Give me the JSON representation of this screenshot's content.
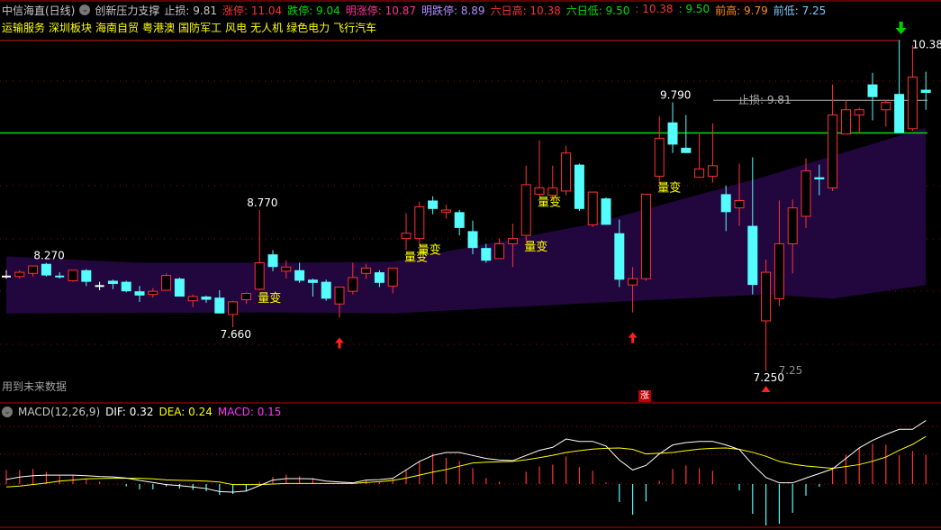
{
  "header": {
    "title": "中信海直(日线)",
    "indicator_name": "创新压力支撑",
    "items": [
      {
        "label": "止损:",
        "value": "9.81",
        "color": "#c8c8c8"
      },
      {
        "label": "涨停:",
        "value": "11.04",
        "color": "#ff3232"
      },
      {
        "label": "跌停:",
        "value": "9.04",
        "color": "#00e000"
      },
      {
        "label": "明涨停:",
        "value": "10.87",
        "color": "#ff3399"
      },
      {
        "label": "明跌停:",
        "value": "8.89",
        "color": "#b48cff"
      },
      {
        "label": "六日高:",
        "value": "10.38",
        "color": "#ff3232"
      },
      {
        "label": "六日低:",
        "value": "9.50",
        "color": "#00e000"
      },
      {
        "label": ":",
        "value": "10.38",
        "color": "#ff3232"
      },
      {
        "label": ":",
        "value": "9.50",
        "color": "#00e000"
      },
      {
        "label": "前高:",
        "value": "9.79",
        "color": "#ff8c1a"
      },
      {
        "label": "前低:",
        "value": "7.25",
        "color": "#80c8ff"
      }
    ]
  },
  "sectors": [
    "运输服务",
    "深圳板块",
    "海南自贸",
    "粤港澳",
    "国防军工",
    "风电",
    "无人机",
    "绿色电力",
    "飞行汽车"
  ],
  "future_data_note": "用到未来数据",
  "zhang_badge": "涨",
  "macd_header": {
    "name": "MACD(12,26,9)",
    "dif": "DIF: 0.32",
    "dea": "DEA: 0.24",
    "macd": "MACD: 0.15"
  },
  "colors": {
    "up": "#ff3232",
    "down": "#54fcfc",
    "band": "#22063e",
    "dif": "#ffffff",
    "dea": "#ffff00",
    "resistance": "#00e000",
    "label": "#ffff00"
  },
  "chart_data": {
    "type": "candlestick",
    "title": "中信海直(日线)",
    "ylim": [
      7.2,
      10.4
    ],
    "candles": [
      [
        8.14,
        8.2,
        8.12,
        8.14
      ],
      [
        8.14,
        8.2,
        8.12,
        8.18
      ],
      [
        8.17,
        8.24,
        8.14,
        8.24
      ],
      [
        8.26,
        8.27,
        8.14,
        8.15
      ],
      [
        8.14,
        8.18,
        8.12,
        8.13
      ],
      [
        8.1,
        8.2,
        8.09,
        8.2
      ],
      [
        8.2,
        8.21,
        8.05,
        8.09
      ],
      [
        8.05,
        8.09,
        8.01,
        8.05
      ],
      [
        8.1,
        8.11,
        8.02,
        8.07
      ],
      [
        8.09,
        8.1,
        7.99,
        8.0
      ],
      [
        8.0,
        8.05,
        7.9,
        7.96
      ],
      [
        7.97,
        8.03,
        7.94,
        8.0
      ],
      [
        8.01,
        8.17,
        8.01,
        8.15
      ],
      [
        8.12,
        8.13,
        7.95,
        7.95
      ],
      [
        7.91,
        7.97,
        7.85,
        7.95
      ],
      [
        7.95,
        7.96,
        7.89,
        7.92
      ],
      [
        7.94,
        8.01,
        7.79,
        7.79
      ],
      [
        7.78,
        7.91,
        7.66,
        7.9
      ],
      [
        7.92,
        7.99,
        7.88,
        7.98
      ],
      [
        8.02,
        8.77,
        8.01,
        8.27
      ],
      [
        8.35,
        8.39,
        8.19,
        8.23
      ],
      [
        8.19,
        8.29,
        8.12,
        8.23
      ],
      [
        8.2,
        8.27,
        8.08,
        8.1
      ],
      [
        8.11,
        8.12,
        7.95,
        8.08
      ],
      [
        8.09,
        8.11,
        7.91,
        7.93
      ],
      [
        7.88,
        8.04,
        7.75,
        8.04
      ],
      [
        8.0,
        8.27,
        7.97,
        8.13
      ],
      [
        8.17,
        8.26,
        8.12,
        8.22
      ],
      [
        8.18,
        8.2,
        8.04,
        8.08
      ],
      [
        8.05,
        8.22,
        7.98,
        8.22
      ],
      [
        8.5,
        8.74,
        8.39,
        8.55
      ],
      [
        8.5,
        8.85,
        8.43,
        8.8
      ],
      [
        8.86,
        8.9,
        8.73,
        8.78
      ],
      [
        8.75,
        8.82,
        8.69,
        8.77
      ],
      [
        8.75,
        8.77,
        8.53,
        8.6
      ],
      [
        8.57,
        8.67,
        8.35,
        8.41
      ],
      [
        8.41,
        8.45,
        8.27,
        8.29
      ],
      [
        8.31,
        8.5,
        8.31,
        8.45
      ],
      [
        8.45,
        8.64,
        8.23,
        8.5
      ],
      [
        8.53,
        9.19,
        8.48,
        9.01
      ],
      [
        8.92,
        9.43,
        8.9,
        8.98
      ],
      [
        8.91,
        9.19,
        8.86,
        8.98
      ],
      [
        8.95,
        9.38,
        8.91,
        9.31
      ],
      [
        9.2,
        9.21,
        8.76,
        8.78
      ],
      [
        8.63,
        8.94,
        8.61,
        8.94
      ],
      [
        8.88,
        8.89,
        8.63,
        8.63
      ],
      [
        8.55,
        8.68,
        8.04,
        8.11
      ],
      [
        8.06,
        8.23,
        7.8,
        8.12
      ],
      [
        8.12,
        8.92,
        8.1,
        8.92
      ],
      [
        9.09,
        9.66,
        9.02,
        9.45
      ],
      [
        9.6,
        9.79,
        9.31,
        9.39
      ],
      [
        9.36,
        9.67,
        9.31,
        9.31
      ],
      [
        9.08,
        9.49,
        9.08,
        9.16
      ],
      [
        9.09,
        9.59,
        9.03,
        9.19
      ],
      [
        8.92,
        9.0,
        8.57,
        8.75
      ],
      [
        8.79,
        9.21,
        8.62,
        8.86
      ],
      [
        8.62,
        9.27,
        7.97,
        8.06
      ],
      [
        7.72,
        8.3,
        7.25,
        8.18
      ],
      [
        7.93,
        8.86,
        7.86,
        8.45
      ],
      [
        8.45,
        8.87,
        8.17,
        8.79
      ],
      [
        8.71,
        9.26,
        8.6,
        9.14
      ],
      [
        9.08,
        9.2,
        8.91,
        9.06
      ],
      [
        8.98,
        9.96,
        8.95,
        9.67
      ],
      [
        9.49,
        9.81,
        9.49,
        9.72
      ],
      [
        9.67,
        9.74,
        9.5,
        9.72
      ],
      [
        9.96,
        10.07,
        9.62,
        9.84
      ],
      [
        9.72,
        9.81,
        9.56,
        9.79
      ],
      [
        9.87,
        10.38,
        9.5,
        9.5
      ],
      [
        9.54,
        10.33,
        9.52,
        10.03
      ],
      [
        9.91,
        10.08,
        9.72,
        9.88
      ]
    ],
    "band": {
      "upper": [
        [
          0,
          8.33
        ],
        [
          10,
          8.27
        ],
        [
          20,
          8.27
        ],
        [
          29,
          8.28
        ],
        [
          44,
          8.64
        ],
        [
          57,
          9.09
        ],
        [
          69,
          9.55
        ]
      ],
      "lower": [
        [
          0,
          7.79
        ],
        [
          20,
          7.8
        ],
        [
          29,
          7.79
        ],
        [
          44,
          7.89
        ],
        [
          57,
          7.97
        ],
        [
          62,
          7.93
        ],
        [
          69,
          8.06
        ]
      ]
    },
    "lines": {
      "resistance": 9.5,
      "stop_loss": 9.81,
      "six_day_high": 10.38,
      "stop_loss_label": "止损: 9.81"
    },
    "price_labels": [
      {
        "index": 3,
        "price": 8.27,
        "text": "8.270"
      },
      {
        "index": 19,
        "price": 8.77,
        "text": "8.770"
      },
      {
        "index": 17,
        "price": 7.66,
        "text": "7.660"
      },
      {
        "index": 50,
        "price": 9.79,
        "text": "9.790"
      },
      {
        "index": 57,
        "price": 7.25,
        "text": "7.250"
      },
      {
        "index": 67,
        "price": 10.38,
        "text": "10.38"
      },
      {
        "index": 57,
        "price": 7.25,
        "text": "7.25"
      }
    ],
    "signals": [
      {
        "index": 19,
        "text": "量变"
      },
      {
        "index": 30,
        "text": "量变"
      },
      {
        "index": 31,
        "text": "量变"
      },
      {
        "index": 39,
        "text": "量变"
      },
      {
        "index": 40,
        "text": "量变"
      },
      {
        "index": 49,
        "text": "量变"
      }
    ],
    "buy_arrows": [
      25,
      47
    ],
    "low_marker": 57,
    "sell_arrow": 67,
    "macd": {
      "dif": [
        0.023,
        0.035,
        0.042,
        0.045,
        0.045,
        0.045,
        0.042,
        0.038,
        0.036,
        0.03,
        0.018,
        0.008,
        -0.003,
        -0.008,
        -0.015,
        -0.023,
        -0.038,
        -0.041,
        -0.035,
        -0.008,
        0.02,
        0.027,
        0.027,
        0.026,
        0.015,
        0.01,
        0.006,
        0.02,
        0.022,
        0.029,
        0.071,
        0.114,
        0.144,
        0.159,
        0.159,
        0.144,
        0.129,
        0.121,
        0.118,
        0.144,
        0.17,
        0.185,
        0.227,
        0.215,
        0.215,
        0.192,
        0.121,
        0.071,
        0.094,
        0.152,
        0.197,
        0.209,
        0.215,
        0.215,
        0.197,
        0.174,
        0.098,
        0.033,
        0.006,
        0.006,
        0.03,
        0.053,
        0.076,
        0.129,
        0.182,
        0.22,
        0.25,
        0.276,
        0.276,
        0.32
      ],
      "dea": [
        -0.015,
        -0.01,
        -0.003,
        0.005,
        0.015,
        0.02,
        0.026,
        0.028,
        0.029,
        0.029,
        0.029,
        0.026,
        0.021,
        0.019,
        0.017,
        0.015,
        0.01,
        -0.003,
        -0.003,
        -0.003,
        0.0,
        0.003,
        0.003,
        0.003,
        0.003,
        0.003,
        0.003,
        0.008,
        0.012,
        0.018,
        0.03,
        0.045,
        0.06,
        0.073,
        0.09,
        0.106,
        0.11,
        0.112,
        0.114,
        0.122,
        0.133,
        0.145,
        0.159,
        0.168,
        0.176,
        0.18,
        0.182,
        0.175,
        0.152,
        0.155,
        0.159,
        0.168,
        0.176,
        0.18,
        0.182,
        0.175,
        0.16,
        0.14,
        0.114,
        0.1,
        0.091,
        0.085,
        0.079,
        0.088,
        0.098,
        0.115,
        0.136,
        0.17,
        0.2,
        0.24
      ],
      "hist": [
        0.071,
        0.071,
        0.076,
        0.062,
        0.042,
        0.044,
        0.026,
        0.012,
        0,
        -0.012,
        -0.027,
        -0.027,
        -0.012,
        -0.023,
        -0.03,
        -0.036,
        -0.055,
        -0.05,
        -0.038,
        0.011,
        0.035,
        0.048,
        0.039,
        0.03,
        0.003,
        0,
        0,
        0.021,
        0.011,
        0.03,
        0.071,
        0.114,
        0.155,
        0.132,
        0.117,
        0.08,
        0.03,
        0.012,
        0,
        0.062,
        0.089,
        0.098,
        0.139,
        0.085,
        0.067,
        0.008,
        -0.091,
        -0.155,
        -0.088,
        0.017,
        0.076,
        0.094,
        0.08,
        0.067,
        0,
        -0.032,
        -0.15,
        -0.209,
        -0.2,
        -0.145,
        -0.059,
        -0.014,
        0.085,
        0.148,
        0.18,
        0.203,
        0.198,
        0.145,
        0.167,
        0.148
      ]
    }
  }
}
